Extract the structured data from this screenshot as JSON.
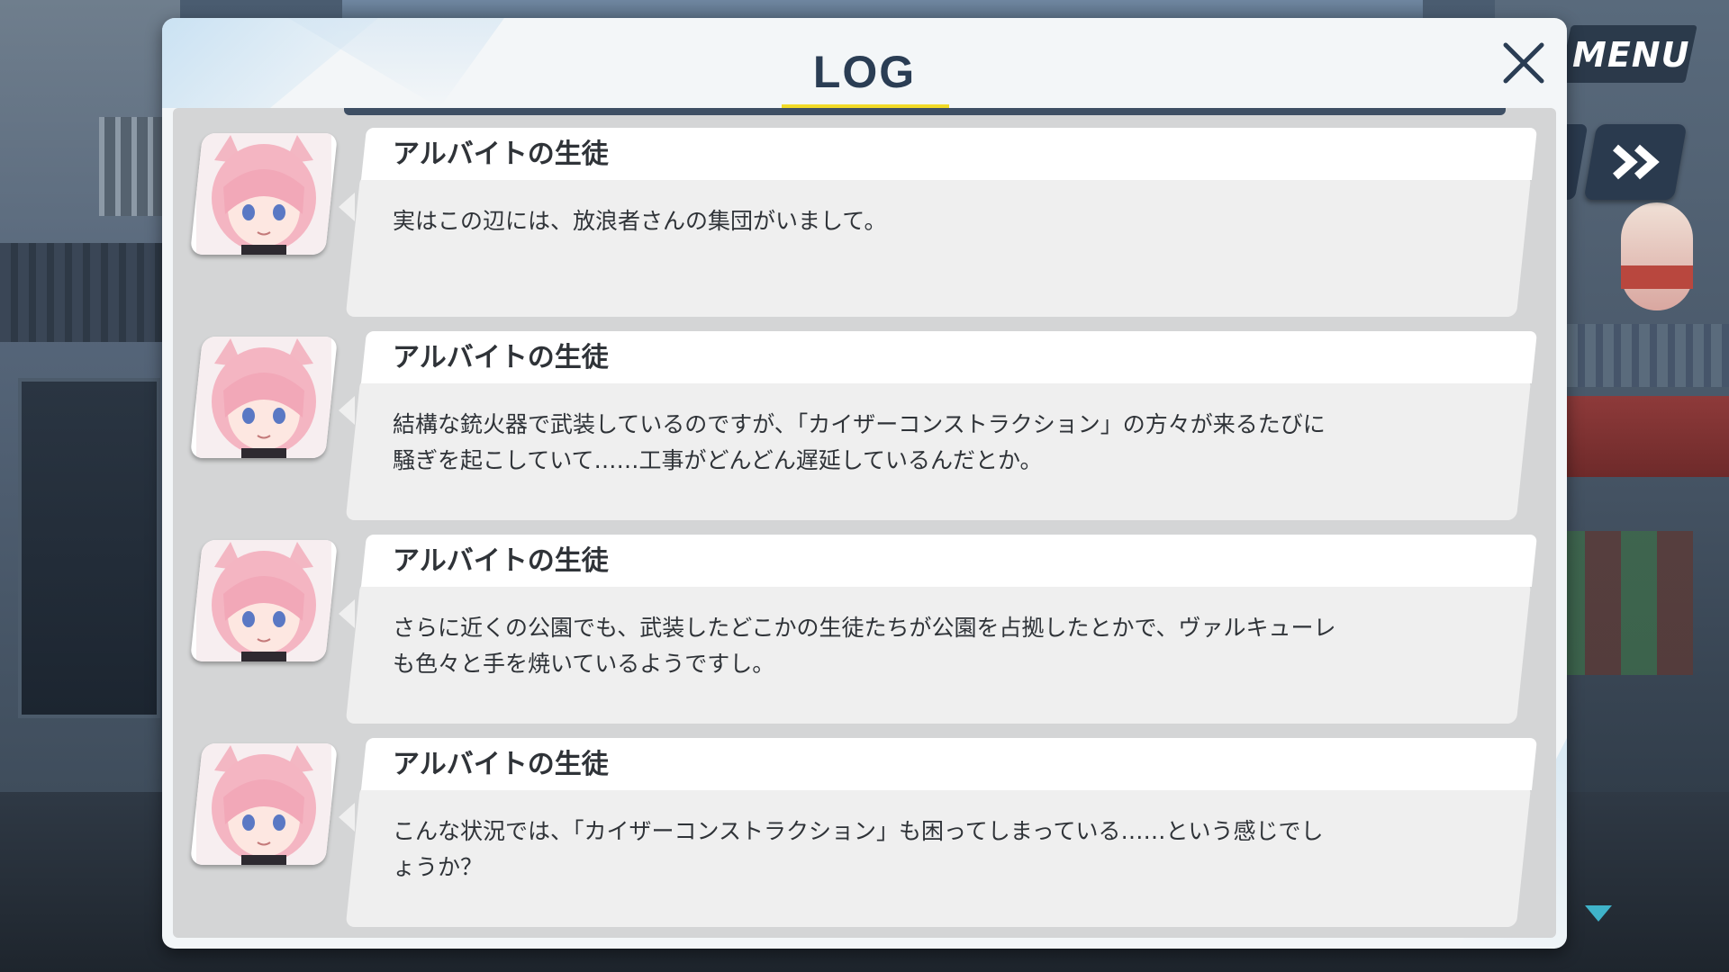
{
  "dialog": {
    "title": "LOG"
  },
  "hud": {
    "menu_label": "MENU"
  },
  "log": {
    "entries": [
      {
        "speaker": "アルバイトの生徒",
        "line1": "実はこの辺には、放浪者さんの集団がいまして。",
        "line2": ""
      },
      {
        "speaker": "アルバイトの生徒",
        "line1": "結構な銃火器で武装しているのですが、「カイザーコンストラクション」の方々が来るたびに",
        "line2": "騒ぎを起こしていて……工事がどんどん遅延しているんだとか。"
      },
      {
        "speaker": "アルバイトの生徒",
        "line1": "さらに近くの公園でも、武装したどこかの生徒たちが公園を占拠したとかで、ヴァルキューレ",
        "line2": "も色々と手を焼いているようですし。"
      },
      {
        "speaker": "アルバイトの生徒",
        "line1": "こんな状況では、「カイザーコンストラクション」も困ってしまっている……という感じでし",
        "line2": "ょうか？"
      }
    ]
  },
  "icons": {
    "close": "close-icon",
    "skip": "fast-forward-icon",
    "scroll_down": "chevron-down-icon",
    "avatar": "character-portrait"
  },
  "colors": {
    "title_text": "#2a3d54",
    "title_underline": "#f1da27",
    "name_bar": "#ffffff",
    "bubble": "#efefef",
    "list_background": "#d4d5d6",
    "hud_button": "#2a3a4e",
    "scroll_arrow": "#3fb3c9"
  }
}
